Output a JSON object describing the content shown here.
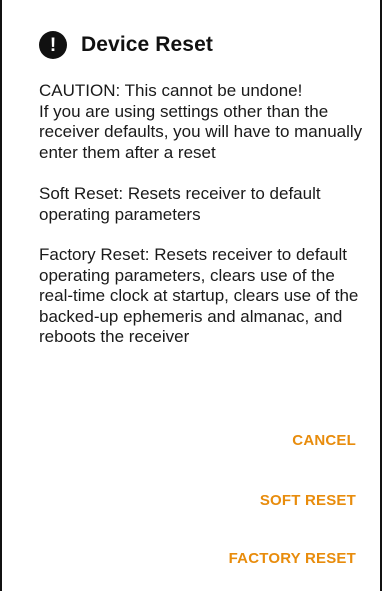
{
  "dialog": {
    "title": "Device Reset",
    "icon": "alert-icon",
    "icon_glyph": "!",
    "paragraphs": {
      "caution": "CAUTION: This cannot be undone!\nIf you are using settings other than the receiver defaults, you will have to manually enter them after a reset",
      "soft": "Soft Reset: Resets receiver to default operating parameters",
      "factory": "Factory Reset: Resets receiver to default operating parameters, clears use of the real-time clock at startup, clears use of the backed-up ephemeris and almanac, and reboots the receiver"
    },
    "buttons": {
      "cancel": "CANCEL",
      "soft_reset": "SOFT RESET",
      "factory_reset": "FACTORY RESET"
    }
  },
  "colors": {
    "accent": "#e88c0c",
    "text": "#1a1a1a",
    "background": "#ffffff"
  }
}
